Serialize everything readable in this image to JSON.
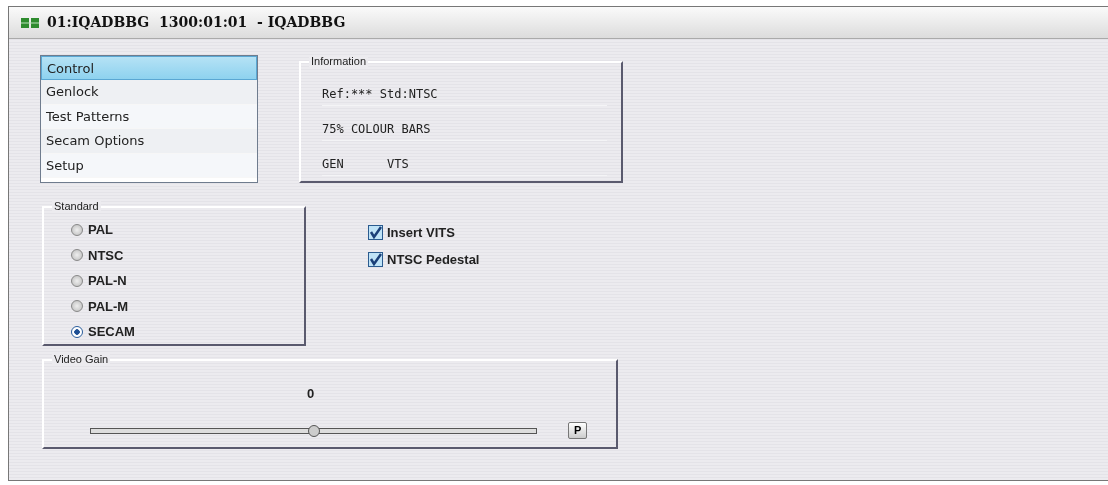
{
  "window": {
    "title": "01:IQADBBG  1300:01:01  - IQADBBG"
  },
  "menu": [
    {
      "label": "Control",
      "selected": true
    },
    {
      "label": "Genlock",
      "selected": false
    },
    {
      "label": "Test Patterns",
      "selected": false
    },
    {
      "label": "Secam Options",
      "selected": false
    },
    {
      "label": "Setup",
      "selected": false
    }
  ],
  "information": {
    "title": "Information",
    "lines": [
      "Ref:*** Std:NTSC",
      "75% COLOUR BARS",
      "GEN      VTS"
    ]
  },
  "standard": {
    "title": "Standard",
    "options": [
      {
        "label": "PAL",
        "selected": false
      },
      {
        "label": "NTSC",
        "selected": false
      },
      {
        "label": "PAL-N",
        "selected": false
      },
      {
        "label": "PAL-M",
        "selected": false
      },
      {
        "label": "SECAM",
        "selected": true
      }
    ]
  },
  "checkboxes": [
    {
      "label": "Insert VITS",
      "checked": true
    },
    {
      "label": "NTSC Pedestal",
      "checked": true
    }
  ],
  "video_gain": {
    "title": "Video Gain",
    "reading": "0",
    "level": 0.5,
    "button": "P"
  }
}
